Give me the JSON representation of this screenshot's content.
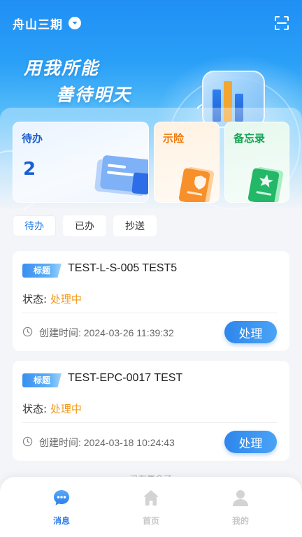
{
  "header": {
    "location": "舟山三期",
    "slogan_line1": "用我所能",
    "slogan_line2": "善待明天"
  },
  "categories": [
    {
      "label": "待办",
      "count": "2",
      "color": "#1a5fd0"
    },
    {
      "label": "示险",
      "color": "#f07a10"
    },
    {
      "label": "备忘录",
      "color": "#17a455"
    }
  ],
  "tabs": [
    {
      "label": "待办",
      "active": true
    },
    {
      "label": "已办",
      "active": false
    },
    {
      "label": "抄送",
      "active": false
    }
  ],
  "tasks": [
    {
      "tag": "标题",
      "title": "TEST-L-S-005 TEST5",
      "status_label": "状态:",
      "status_value": "处理中",
      "created_label": "创建时间:",
      "created_time": "2024-03-26 11:39:32",
      "action": "处理"
    },
    {
      "tag": "标题",
      "title": "TEST-EPC-0017 TEST",
      "status_label": "状态:",
      "status_value": "处理中",
      "created_label": "创建时间:",
      "created_time": "2024-03-18 10:24:43",
      "action": "处理"
    }
  ],
  "list_footer": "没有更多了",
  "bottom_nav": [
    {
      "label": "消息",
      "icon": "message-icon",
      "active": true
    },
    {
      "label": "首页",
      "icon": "home-icon",
      "active": false
    },
    {
      "label": "我的",
      "icon": "user-icon",
      "active": false
    }
  ],
  "colors": {
    "primary": "#2b7de9",
    "status_processing": "#f39a1c",
    "header_blue": "#1f8ff5"
  }
}
